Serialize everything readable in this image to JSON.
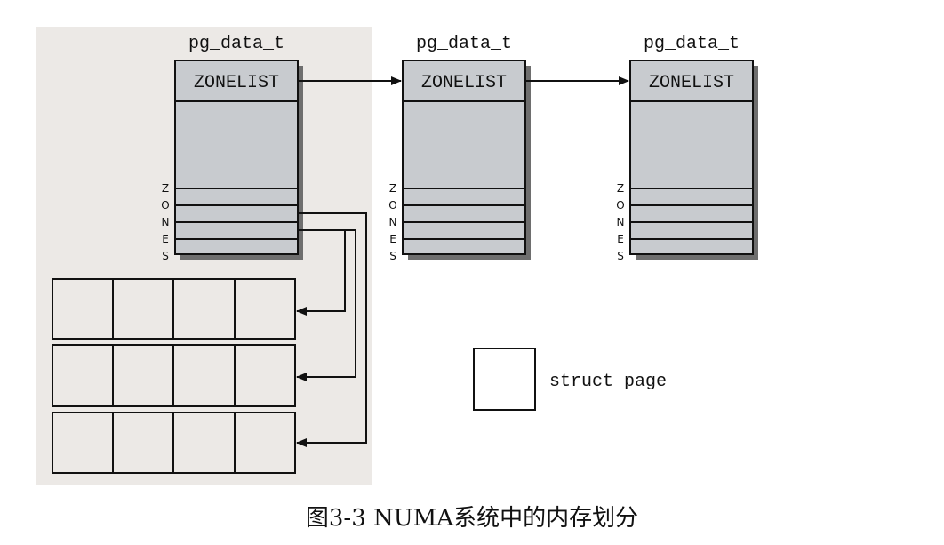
{
  "diagram": {
    "nodes": [
      {
        "struct_label": "pg_data_t",
        "zonelist_label": "ZONELIST",
        "zones_letters": [
          "Z",
          "O",
          "N",
          "E",
          "S"
        ]
      },
      {
        "struct_label": "pg_data_t",
        "zonelist_label": "ZONELIST",
        "zones_letters": [
          "Z",
          "O",
          "N",
          "E",
          "S"
        ]
      },
      {
        "struct_label": "pg_data_t",
        "zonelist_label": "ZONELIST",
        "zones_letters": [
          "Z",
          "O",
          "N",
          "E",
          "S"
        ]
      }
    ],
    "legend": {
      "label": "struct page"
    },
    "caption": "图3-3    NUMA系统中的内存划分"
  },
  "colors": {
    "highlight_bg": "#ece9e6",
    "node_fill": "#c8cbcf",
    "shadow": "#6e6e6e",
    "stroke": "#111111"
  }
}
